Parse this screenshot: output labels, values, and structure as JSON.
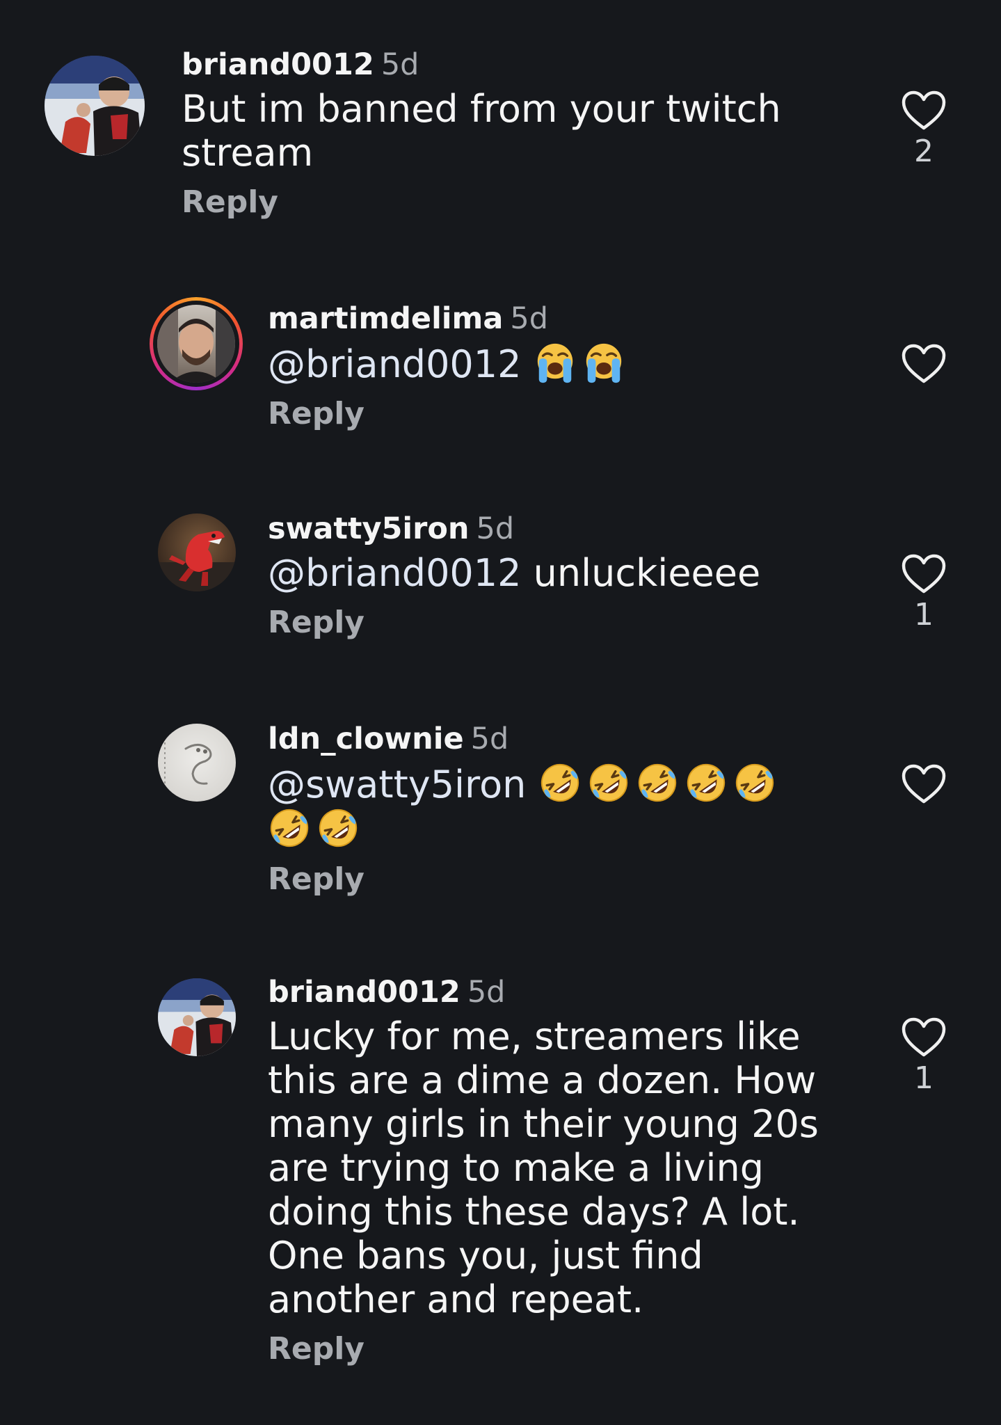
{
  "comments": [
    {
      "username": "briand0012",
      "time": "5d",
      "text": "But im banned from your twitch stream",
      "reply_label": "Reply",
      "likes": "2",
      "avatar": "hockey-selfie-avatar"
    },
    {
      "username": "martimdelima",
      "time": "5d",
      "mention": "@briand0012",
      "emojis": [
        "loudly-crying-face-emoji",
        "loudly-crying-face-emoji"
      ],
      "reply_label": "Reply",
      "likes": "",
      "avatar": "man-portrait-avatar-with-story-ring"
    },
    {
      "username": "swatty5iron",
      "time": "5d",
      "mention": "@briand0012",
      "text": "unluckieeee",
      "reply_label": "Reply",
      "likes": "1",
      "avatar": "red-dinosaur-toy-avatar"
    },
    {
      "username": "ldn_clownie",
      "time": "5d",
      "mention": "@swatty5iron",
      "emojis": [
        "rolling-on-floor-laughing-emoji",
        "rolling-on-floor-laughing-emoji",
        "rolling-on-floor-laughing-emoji",
        "rolling-on-floor-laughing-emoji",
        "rolling-on-floor-laughing-emoji",
        "rolling-on-floor-laughing-emoji",
        "rolling-on-floor-laughing-emoji"
      ],
      "reply_label": "Reply",
      "likes": "",
      "avatar": "pencil-sketch-avatar"
    },
    {
      "username": "briand0012",
      "time": "5d",
      "text": "Lucky for me, streamers like this are a dime a dozen. How many girls in their young 20s are trying to make a living doing this these days? A lot. One bans you, just find another and repeat.",
      "reply_label": "Reply",
      "likes": "1",
      "avatar": "hockey-selfie-avatar"
    }
  ],
  "colors": {
    "background": "#16181c",
    "text": "#f5f5f5",
    "secondary": "#a8abb0"
  }
}
